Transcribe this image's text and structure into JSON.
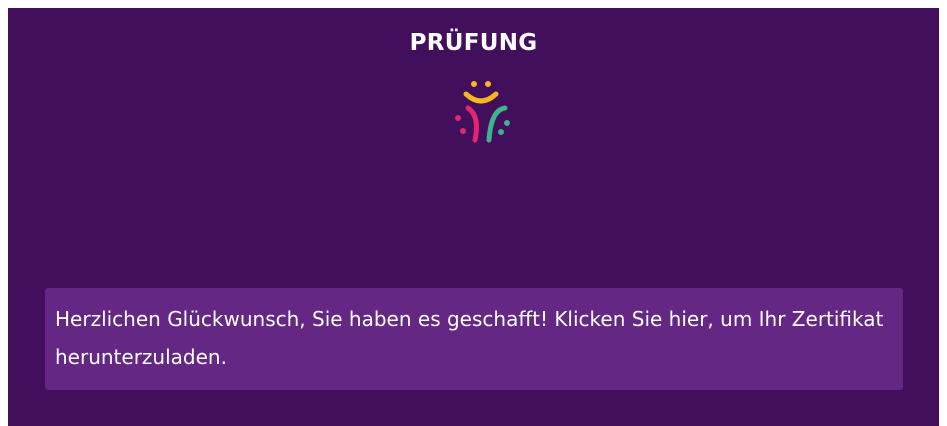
{
  "page": {
    "title": "PRÜFUNG",
    "logo_icon": "smiley-logo-icon",
    "notice_text": "Herzlichen Glückwunsch, Sie haben es geschafft! Klicken Sie hier, um Ihr Zertifikat herunterzuladen."
  },
  "colors": {
    "background": "#410f5c",
    "notice_background": "#642784",
    "text": "#ffffff",
    "logo_yellow": "#f6b81c",
    "logo_pink": "#e4266f",
    "logo_green": "#3fb38c"
  }
}
